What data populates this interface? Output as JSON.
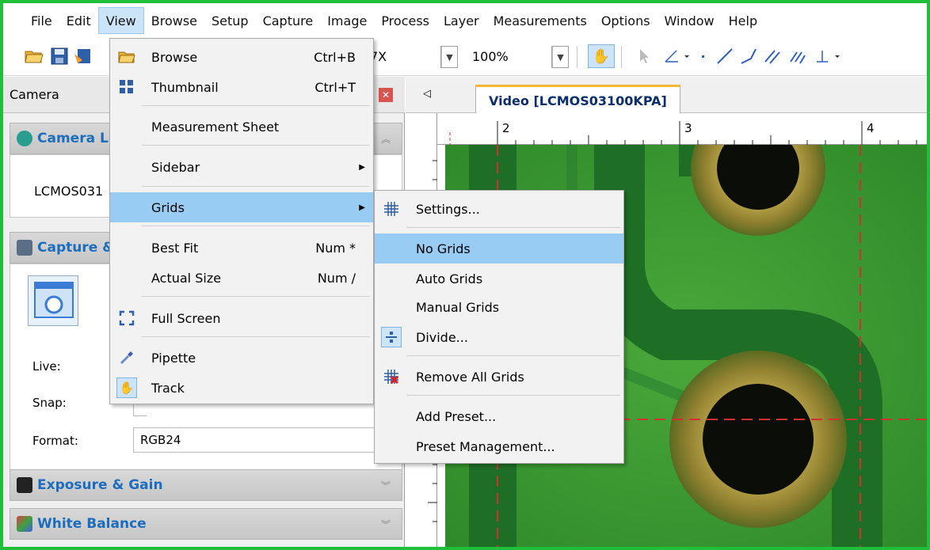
{
  "menubar": {
    "items": [
      "File",
      "Edit",
      "View",
      "Browse",
      "Setup",
      "Capture",
      "Image",
      "Process",
      "Layer",
      "Measurements",
      "Options",
      "Window",
      "Help"
    ],
    "active": "View"
  },
  "toolbar": {
    "zoom_partial": "7X",
    "zoom_percent": "100%"
  },
  "camera_panel": {
    "title": "Camera",
    "camera_list_label": "Camera L",
    "camera_name": "LCMOS031",
    "capture_label": "Capture &",
    "live_label": "Live:",
    "snap_label": "Snap:",
    "format_label": "Format:",
    "format_value": "RGB24",
    "exposure_label": "Exposure & Gain",
    "white_balance_label": "White Balance"
  },
  "video": {
    "tab_title": "Video [LCMOS03100KPA]",
    "ruler_labels": [
      "2",
      "3",
      "4"
    ]
  },
  "view_menu": {
    "items": [
      {
        "label": "Browse",
        "shortcut": "Ctrl+B",
        "icon": "folder-icon"
      },
      {
        "label": "Thumbnail",
        "shortcut": "Ctrl+T",
        "icon": "thumbnail-icon"
      },
      {
        "label": "Measurement Sheet",
        "shortcut": ""
      },
      {
        "label": "Sidebar",
        "shortcut": ""
      },
      {
        "label": "Grids",
        "shortcut": ""
      },
      {
        "label": "Best Fit",
        "shortcut": "Num *"
      },
      {
        "label": "Actual Size",
        "shortcut": "Num /"
      },
      {
        "label": "Full Screen",
        "shortcut": "",
        "icon": "fullscreen-icon"
      },
      {
        "label": "Pipette",
        "shortcut": "",
        "icon": "pipette-icon"
      },
      {
        "label": "Track",
        "shortcut": "",
        "icon": "hand-icon"
      }
    ],
    "highlighted": "Grids"
  },
  "grids_menu": {
    "items": [
      {
        "label": "Settings...",
        "icon": "grid-settings-icon"
      },
      {
        "label": "No Grids"
      },
      {
        "label": "Auto Grids"
      },
      {
        "label": "Manual Grids"
      },
      {
        "label": "Divide...",
        "icon": "divide-icon"
      },
      {
        "label": "Remove All Grids",
        "icon": "remove-grids-icon"
      },
      {
        "label": "Add Preset..."
      },
      {
        "label": "Preset Management..."
      }
    ],
    "highlighted": "No Grids"
  },
  "colors": {
    "frame": "#1fbf3a",
    "highlight": "#99ccf3",
    "group_title": "#1d6dbe",
    "tab_title": "#0c2d6b",
    "pcb_green": "#3d9b2e",
    "grid_line": "#d23030"
  }
}
